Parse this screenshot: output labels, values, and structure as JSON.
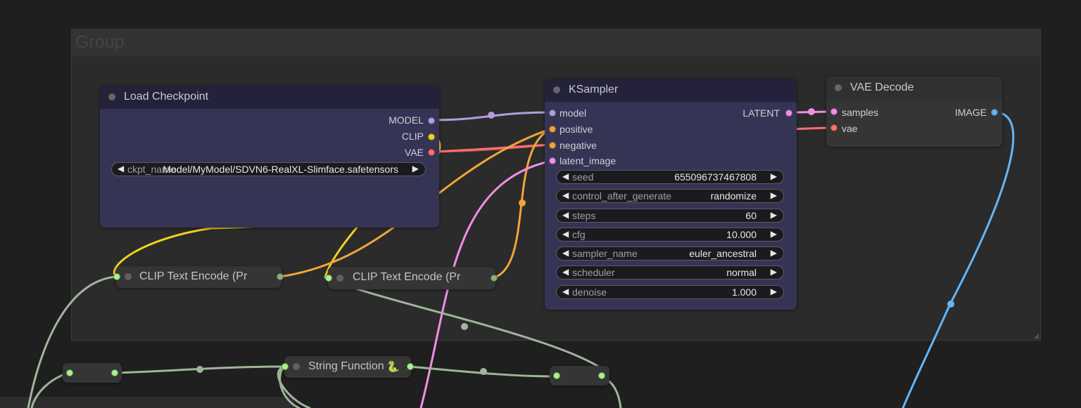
{
  "group": {
    "title": "Group"
  },
  "load_checkpoint": {
    "title": "Load Checkpoint",
    "outputs": [
      "MODEL",
      "CLIP",
      "VAE"
    ],
    "widget": {
      "label": "ckpt_name",
      "value": "Model/MyModel/SDVN6-RealXL-Slimface.safetensors"
    }
  },
  "ksampler": {
    "title": "KSampler",
    "inputs": [
      "model",
      "positive",
      "negative",
      "latent_image"
    ],
    "output": "LATENT",
    "widgets": [
      {
        "label": "seed",
        "value": "655096737467808"
      },
      {
        "label": "control_after_generate",
        "value": "randomize"
      },
      {
        "label": "steps",
        "value": "60"
      },
      {
        "label": "cfg",
        "value": "10.000"
      },
      {
        "label": "sampler_name",
        "value": "euler_ancestral"
      },
      {
        "label": "scheduler",
        "value": "normal"
      },
      {
        "label": "denoise",
        "value": "1.000"
      }
    ]
  },
  "vae_decode": {
    "title": "VAE Decode",
    "inputs": [
      "samples",
      "vae"
    ],
    "output": "IMAGE"
  },
  "clip_text_encode_1": {
    "title": "CLIP Text Encode (Pr"
  },
  "clip_text_encode_2": {
    "title": "CLIP Text Encode (Pr"
  },
  "string_function": {
    "title": "String Function",
    "icon": "snake-icon"
  },
  "colors": {
    "model": "#b39ddb",
    "clip": "#f2d21c",
    "vae": "#ff6e6e",
    "conditioning": "#f0a43a",
    "latent": "#f08ee6",
    "image": "#64b5f6",
    "string": "#9fb59a",
    "node_body": "#353454",
    "node_header": "#23223a"
  }
}
